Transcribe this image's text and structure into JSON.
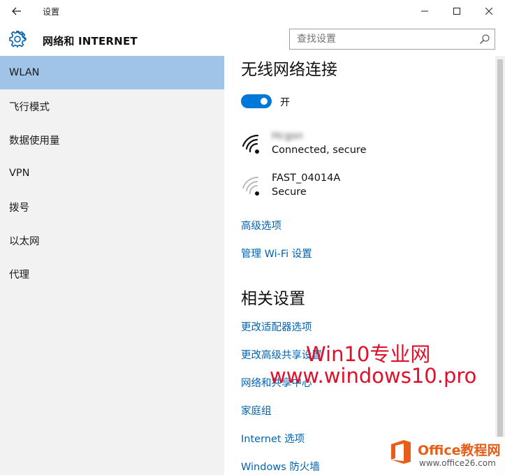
{
  "window": {
    "title": "设置",
    "back_icon": "back-arrow-icon",
    "controls": [
      "minimize-icon",
      "maximize-icon",
      "close-icon"
    ]
  },
  "header": {
    "icon": "gear-icon",
    "title": "网络和 INTERNET",
    "search_placeholder": "查找设置",
    "search_icon": "search-icon"
  },
  "sidebar": {
    "items": [
      {
        "label": "WLAN",
        "selected": true
      },
      {
        "label": "飞行模式",
        "selected": false
      },
      {
        "label": "数据使用量",
        "selected": false
      },
      {
        "label": "VPN",
        "selected": false
      },
      {
        "label": "拨号",
        "selected": false
      },
      {
        "label": "以太网",
        "selected": false
      },
      {
        "label": "代理",
        "selected": false
      }
    ]
  },
  "main": {
    "wireless_heading": "无线网络连接",
    "toggle": {
      "state": "on",
      "label": "开"
    },
    "networks": [
      {
        "name": "Hcgsn",
        "status": "Connected, secure",
        "icon": "wifi-strong-icon",
        "name_blurred": true
      },
      {
        "name": "FAST_04014A",
        "status": "Secure",
        "icon": "wifi-weak-icon",
        "name_blurred": false
      }
    ],
    "links": [
      "高级选项",
      "管理 Wi-Fi 设置"
    ],
    "related_heading": "相关设置",
    "related_links": [
      "更改适配器选项",
      "更改高级共享设置",
      "网络和共享中心",
      "家庭组",
      "Internet 选项",
      "Windows 防火墙"
    ]
  },
  "watermarks": {
    "line1": "Win10专业网",
    "line2": "www.windows10.pro",
    "office_title": "Office教程网",
    "office_url": "www.office26.com"
  },
  "colors": {
    "accent": "#0078d7",
    "link": "#0063b1",
    "sidebar_bg": "#f2f2f2",
    "selected_bg": "#9fc4e8",
    "watermark": "#e0102a",
    "office_orange": "#e85d17"
  }
}
